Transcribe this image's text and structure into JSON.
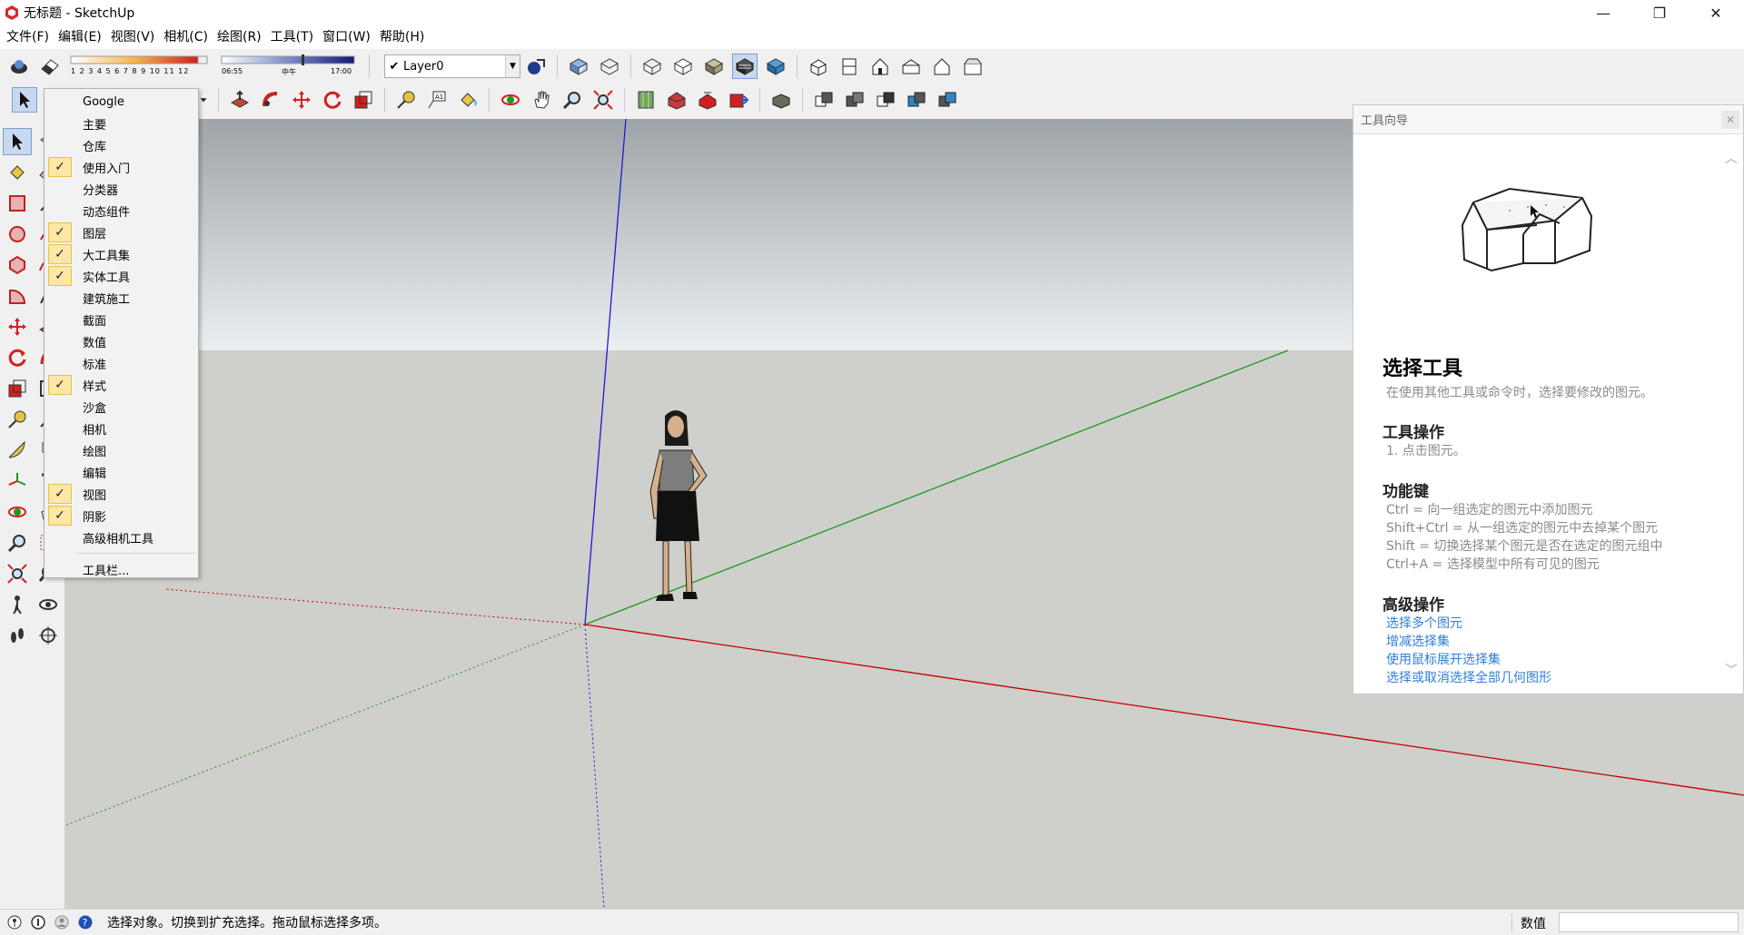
{
  "window": {
    "title": "无标题 - SketchUp",
    "minimize": "—",
    "maximize": "❐",
    "close": "✕"
  },
  "menubar": [
    "文件(F)",
    "编辑(E)",
    "视图(V)",
    "相机(C)",
    "绘图(R)",
    "工具(T)",
    "窗口(W)",
    "帮助(H)"
  ],
  "toolbar": {
    "scale_ticks": "1 2 3 4 5 6 7 8 9 10 11 12",
    "shadow_time_start": "06:55",
    "shadow_time_mid": "中午",
    "shadow_time_end": "17:00",
    "layer_check": "✔",
    "layer_name": "Layer0",
    "layer_drop": "▼"
  },
  "context_menu": {
    "items": [
      {
        "label": "Google",
        "checked": false
      },
      {
        "label": "主要",
        "checked": false
      },
      {
        "label": "仓库",
        "checked": false
      },
      {
        "label": "使用入门",
        "checked": true
      },
      {
        "label": "分类器",
        "checked": false
      },
      {
        "label": "动态组件",
        "checked": false
      },
      {
        "label": "图层",
        "checked": true
      },
      {
        "label": "大工具集",
        "checked": true
      },
      {
        "label": "实体工具",
        "checked": true
      },
      {
        "label": "建筑施工",
        "checked": false
      },
      {
        "label": "截面",
        "checked": false
      },
      {
        "label": "数值",
        "checked": false
      },
      {
        "label": "标准",
        "checked": false
      },
      {
        "label": "样式",
        "checked": true
      },
      {
        "label": "沙盒",
        "checked": false
      },
      {
        "label": "相机",
        "checked": false
      },
      {
        "label": "绘图",
        "checked": false
      },
      {
        "label": "编辑",
        "checked": false
      },
      {
        "label": "视图",
        "checked": true
      },
      {
        "label": "阴影",
        "checked": true
      },
      {
        "label": "高级相机工具",
        "checked": false
      }
    ],
    "footer": "工具栏...",
    "check_glyph": "✓"
  },
  "instructor": {
    "panel_title": "工具向导",
    "close": "✕",
    "tool_name": "选择工具",
    "tool_desc": "在使用其他工具或命令时，选择要修改的图元。",
    "ops_heading": "工具操作",
    "ops": [
      "1.    点击图元。"
    ],
    "keys_heading": "功能键",
    "keys": [
      "Ctrl = 向一组选定的图元中添加图元",
      "Shift+Ctrl = 从一组选定的图元中去掉某个图元",
      "Shift = 切换选择某个图元是否在选定的图元组中",
      "Ctrl+A = 选择模型中所有可见的图元"
    ],
    "adv_heading": "高级操作",
    "adv_links": [
      "选择多个图元",
      "增减选择集",
      "使用鼠标展开选择集",
      "选择或取消选择全部几何图形"
    ],
    "scroll_up": "︿",
    "scroll_down": "﹀"
  },
  "statusbar": {
    "message": "选择对象。切换到扩充选择。拖动鼠标选择多项。",
    "value_label": "数值",
    "value": ""
  },
  "colors": {
    "red_axis": "#c40000",
    "green_axis": "#1a9a1a",
    "blue_axis": "#1010c0",
    "link": "#2f7fd8",
    "sky_top": "#9fa4a8",
    "ground": "#cfcfcb"
  }
}
